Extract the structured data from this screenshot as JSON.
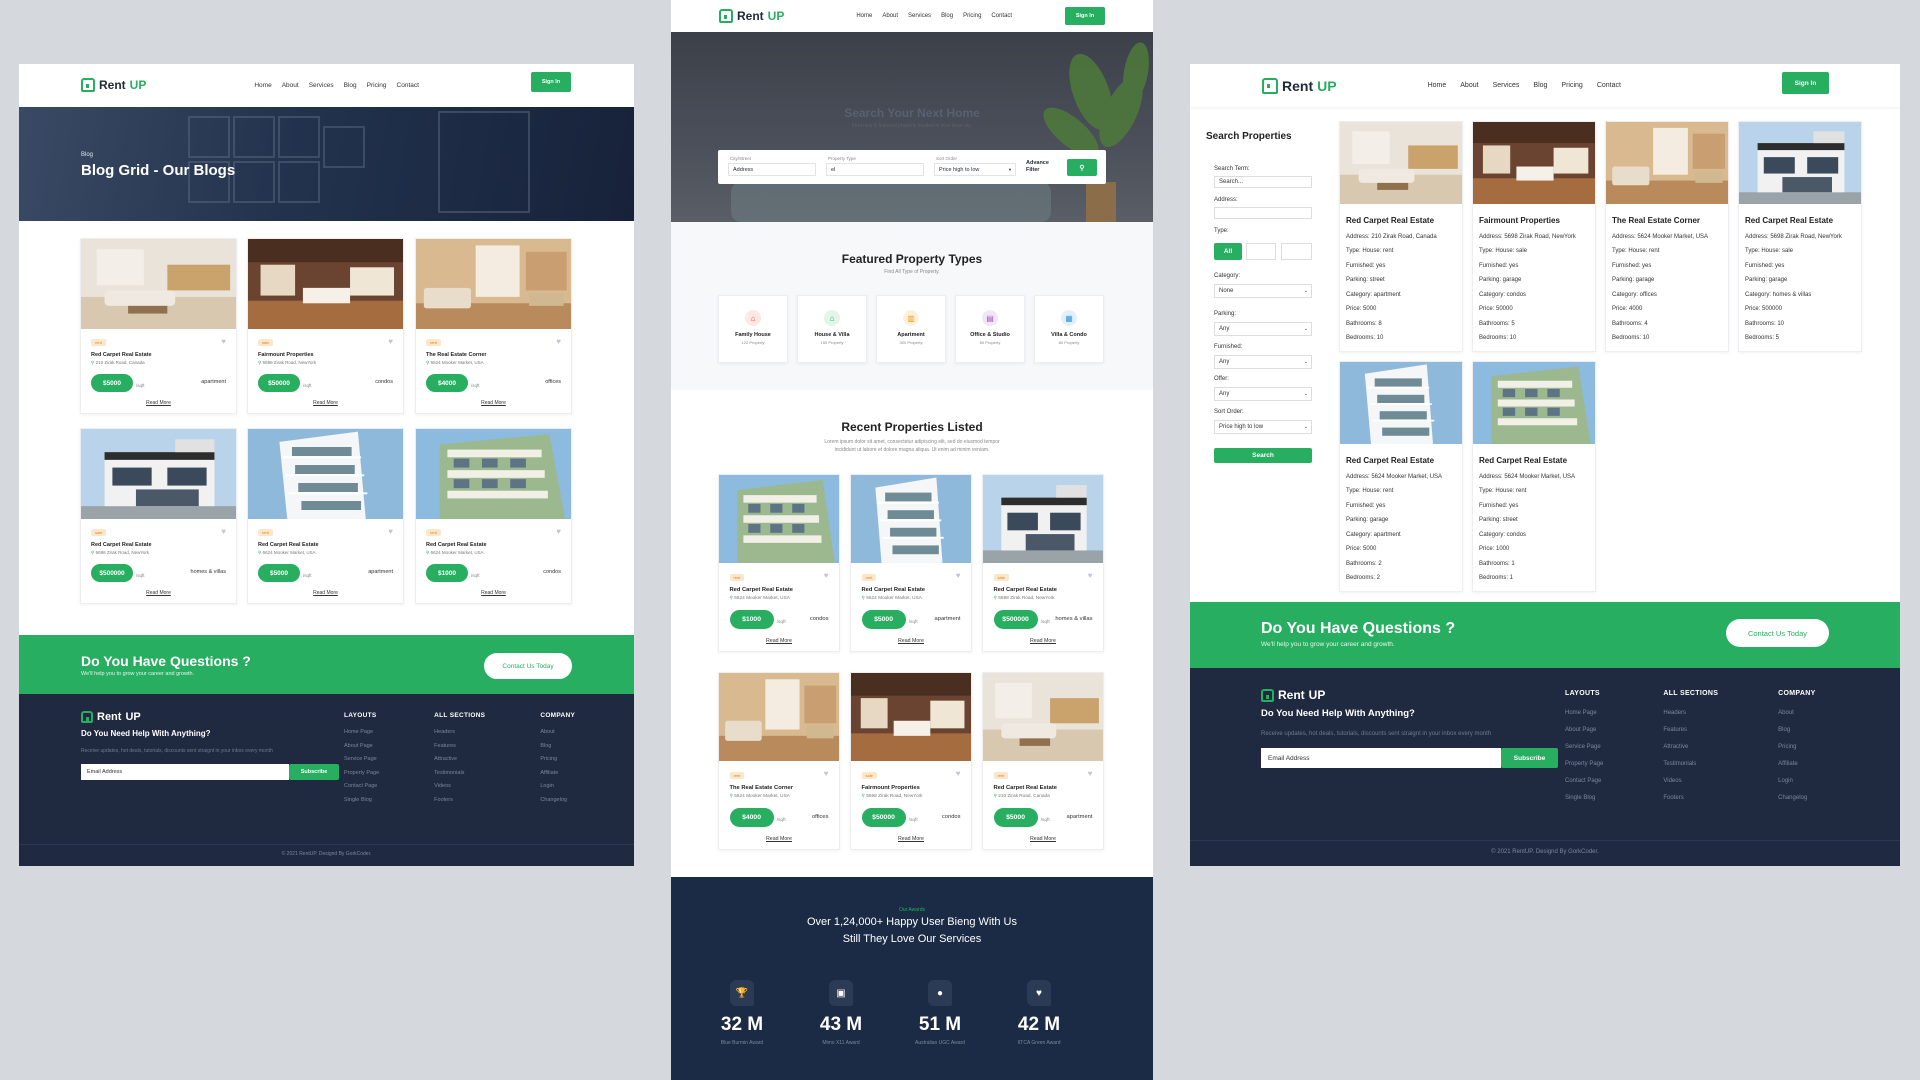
{
  "brand": {
    "prefix": "Rent",
    "suffix": "UP"
  },
  "nav": [
    "Home",
    "About",
    "Services",
    "Blog",
    "Pricing",
    "Contact"
  ],
  "signin": "Sign In",
  "left": {
    "breadcrumb": "Blog",
    "title": "Blog Grid - Our Blogs",
    "cards": [
      {
        "tag": "rent",
        "title": "Red Carpet Real Estate",
        "addr": "210 Zirak Road, Canada",
        "price": "$5000",
        "sqft": "/sqft",
        "type": "apartment",
        "more": "Read More",
        "img": "interior1"
      },
      {
        "tag": "sale",
        "title": "Fairmount Properties",
        "addr": "5698 Zirak Road, NewYork",
        "price": "$50000",
        "sqft": "/sqft",
        "type": "condos",
        "more": "Read More",
        "img": "interior2"
      },
      {
        "tag": "rent",
        "title": "The Real Estate Corner",
        "addr": "5624 Mooker Market, USA",
        "price": "$4000",
        "sqft": "/sqft",
        "type": "offices",
        "more": "Read More",
        "img": "interior3"
      },
      {
        "tag": "sale",
        "title": "Red Carpet Real Estate",
        "addr": "5698 Zirak Road, NewYork",
        "price": "$500000",
        "sqft": "/sqft",
        "type": "homes & villas",
        "more": "Read More",
        "img": "house"
      },
      {
        "tag": "rent",
        "title": "Red Carpet Real Estate",
        "addr": "5624 Mooker Market, USA",
        "price": "$5000",
        "sqft": "/sqft",
        "type": "apartment",
        "more": "Read More",
        "img": "balcony"
      },
      {
        "tag": "rent",
        "title": "Red Carpet Real Estate",
        "addr": "5624 Mooker Market, USA",
        "price": "$1000",
        "sqft": "/sqft",
        "type": "condos",
        "more": "Read More",
        "img": "building"
      }
    ]
  },
  "cta": {
    "title": "Do You Have Questions ?",
    "sub": "We'll help you to grow your career and growth.",
    "button": "Contact Us Today"
  },
  "footer": {
    "help": "Do You Need Help With Anything?",
    "desc": "Receive updates, hot deals, tutorials, discounts sent straignt in your inbox every month",
    "email_placeholder": "Email Address",
    "subscribe": "Subscribe",
    "cols": [
      {
        "title": "LAYOUTS",
        "items": [
          "Home Page",
          "About Page",
          "Service Page",
          "Property Page",
          "Contact Page",
          "Single Blog"
        ]
      },
      {
        "title": "ALL SECTIONS",
        "items": [
          "Headers",
          "Features",
          "Attractive",
          "Testimonials",
          "Videos",
          "Footers"
        ]
      },
      {
        "title": "COMPANY",
        "items": [
          "About",
          "Blog",
          "Pricing",
          "Affiliate",
          "Login",
          "Changelog"
        ]
      }
    ],
    "copyright": "© 2021 RentUP. Designd By GorkCoder."
  },
  "middle": {
    "hero_title": "Search Your Next Home",
    "hero_sub": "Find new & featured property located in your local city.",
    "search": {
      "city_label": "City/Street",
      "city_value": "Address",
      "type_label": "Property Type",
      "type_value": "el",
      "sort_label": "Sort Order",
      "sort_value": "Price high to low",
      "advance": "Advance Filter"
    },
    "featured_title": "Featured Property Types",
    "featured_sub": "Find All Type of Property.",
    "types": [
      {
        "name": "Family House",
        "count": "122 Property",
        "icon": "family-house-icon",
        "glyph": "⌂",
        "color": "#e74c3c",
        "bg": "#fde8e6"
      },
      {
        "name": "House & Villa",
        "count": "155 Property",
        "icon": "villa-icon",
        "glyph": "⌂",
        "color": "#27ae60",
        "bg": "#e3f5ea"
      },
      {
        "name": "Apartment",
        "count": "300 Property",
        "icon": "apartment-icon",
        "glyph": "▥",
        "color": "#f39c12",
        "bg": "#fdf1dc"
      },
      {
        "name": "Office & Studio",
        "count": "80 Property",
        "icon": "office-icon",
        "glyph": "▤",
        "color": "#9b59b6",
        "bg": "#f1e6f6"
      },
      {
        "name": "Villa & Condo",
        "count": "80 Property",
        "icon": "condo-icon",
        "glyph": "▦",
        "color": "#3498db",
        "bg": "#e3effa"
      }
    ],
    "recent_title": "Recent Properties Listed",
    "recent_sub1": "Lorem ipsum dolor sit amet, consectetur adipiscing elit, sed do eiusmod tempor",
    "recent_sub2": "incididunt ut labore et dolore magna aliqua. Ut enim ad minim veniam.",
    "cards": [
      {
        "tag": "rent",
        "title": "Red Carpet Real Estate",
        "addr": "5624 Mooker Market, USA",
        "price": "$1000",
        "sqft": "/sqft",
        "type": "condos",
        "more": "Read More",
        "img": "building"
      },
      {
        "tag": "rent",
        "title": "Red Carpet Real Estate",
        "addr": "5624 Mooker Market, USA",
        "price": "$5000",
        "sqft": "/sqft",
        "type": "apartment",
        "more": "Read More",
        "img": "balcony"
      },
      {
        "tag": "sale",
        "title": "Red Carpet Real Estate",
        "addr": "5698 Zirak Road, NewYork",
        "price": "$500000",
        "sqft": "/sqft",
        "type": "homes & villas",
        "more": "Read More",
        "img": "house"
      },
      {
        "tag": "rent",
        "title": "The Real Estate Corner",
        "addr": "5624 Mooker Market, USA",
        "price": "$4000",
        "sqft": "/sqft",
        "type": "offices",
        "more": "Read More",
        "img": "interior3"
      },
      {
        "tag": "sale",
        "title": "Fairmount Properties",
        "addr": "5698 Zirak Road, NewYork",
        "price": "$50000",
        "sqft": "/sqft",
        "type": "condos",
        "more": "Read More",
        "img": "interior2"
      },
      {
        "tag": "rent",
        "title": "Red Carpet Real Estate",
        "addr": "210 Zirak Road, Canada",
        "price": "$5000",
        "sqft": "/sqft",
        "type": "apartment",
        "more": "Read More",
        "img": "interior1"
      }
    ],
    "awards_label": "Our Awards",
    "awards_title1": "Over 1,24,000+ Happy User Bieng With Us",
    "awards_title2": "Still They Love Our Services",
    "stats": [
      {
        "value": "32 M",
        "label": "Blue Burmin Award",
        "icon": "trophy-icon",
        "glyph": "🏆"
      },
      {
        "value": "43 M",
        "label": "Mimo X11 Award",
        "icon": "briefcase-icon",
        "glyph": "▣"
      },
      {
        "value": "51 M",
        "label": "Australian UGC Award",
        "icon": "lightbulb-icon",
        "glyph": "●"
      },
      {
        "value": "42 M",
        "label": "IITCA Green Award",
        "icon": "heart-icon",
        "glyph": "♥"
      }
    ]
  },
  "right": {
    "search_title": "Search Properties",
    "search_term_label": "Search Term:",
    "search_placeholder": "Search...",
    "address_label": "Address:",
    "type_label": "Type:",
    "type_all": "All",
    "category_label": "Category:",
    "category_value": "None",
    "parking_label": "Parking:",
    "parking_value": "Any",
    "furnished_label": "Furnished:",
    "furnished_value": "Any",
    "offer_label": "Offer:",
    "offer_value": "Any",
    "sort_label": "Sort Order:",
    "sort_value": "Price high to low",
    "search_button": "Search",
    "listings": [
      {
        "title": "Red Carpet Real Estate",
        "lines": [
          "Address: 210 Zirak Road, Canada",
          "Type: House: rent",
          "Furnished: yes",
          "Parking: street",
          "Category: apartment",
          "Price: 5000",
          "Bathrooms: 8",
          "Bedrooms: 10"
        ],
        "img": "interior1"
      },
      {
        "title": "Fairmount Properties",
        "lines": [
          "Address: 5698 Zirak Road, NewYork",
          "Type: House: sale",
          "Furnished: yes",
          "Parking: garage",
          "Category: condos",
          "Price: 50000",
          "Bathrooms: 5",
          "Bedrooms: 10"
        ],
        "img": "interior2"
      },
      {
        "title": "The Real Estate Corner",
        "lines": [
          "Address: 5624 Mooker Market, USA",
          "Type: House: rent",
          "Furnished: yes",
          "Parking: garage",
          "Category: offices",
          "Price: 4000",
          "Bathrooms: 4",
          "Bedrooms: 10"
        ],
        "img": "interior3"
      },
      {
        "title": "Red Carpet Real Estate",
        "lines": [
          "Address: 5698 Zirak Road, NewYork",
          "Type: House: sale",
          "Furnished: yes",
          "Parking: garage",
          "Category: homes & villas",
          "Price: 500000",
          "Bathrooms: 10",
          "Bedrooms: 5"
        ],
        "img": "house"
      },
      {
        "title": "Red Carpet Real Estate",
        "lines": [
          "Address: 5624 Mooker Market, USA",
          "Type: House: rent",
          "Furnished: yes",
          "Parking: garage",
          "Category: apartment",
          "Price: 5000",
          "Bathrooms: 2",
          "Bedrooms: 2"
        ],
        "img": "balcony"
      },
      {
        "title": "Red Carpet Real Estate",
        "lines": [
          "Address: 5624 Mooker Market, USA",
          "Type: House: rent",
          "Furnished: yes",
          "Parking: street",
          "Category: condos",
          "Price: 1000",
          "Bathrooms: 1",
          "Bedrooms: 1"
        ],
        "img": "building"
      }
    ]
  }
}
